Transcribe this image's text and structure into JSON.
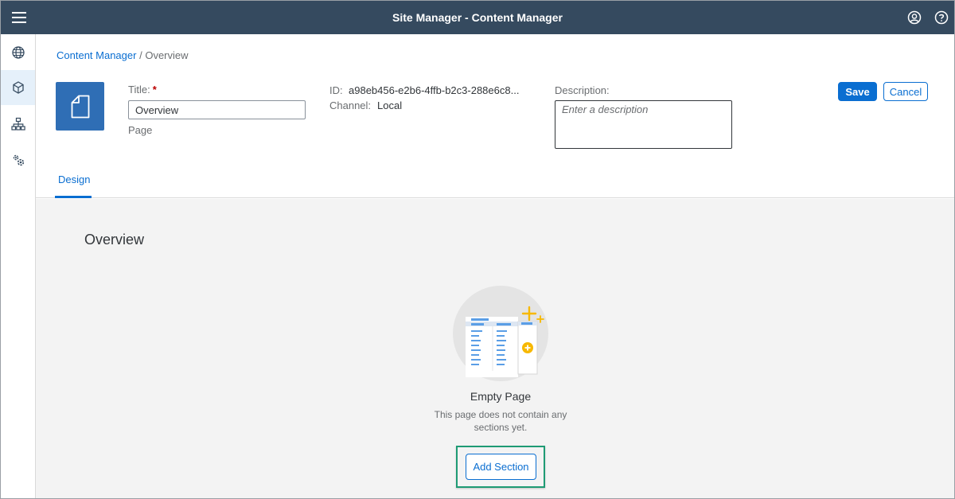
{
  "shell": {
    "title": "Site Manager - Content Manager"
  },
  "icons": {
    "menu": "hamburger-menu-icon",
    "user": "user-profile-icon",
    "help": "help-icon",
    "nav": [
      "globe-icon",
      "cube-icon",
      "hierarchy-icon",
      "settings-icon"
    ]
  },
  "breadcrumb": {
    "link": "Content Manager",
    "separator": "/",
    "current": "Overview"
  },
  "header": {
    "title_label": "Title:",
    "required_mark": "*",
    "title_value": "Overview",
    "type": "Page",
    "id_label": "ID:",
    "id_value": "a98eb456-e2b6-4ffb-b2c3-288e6c8...",
    "channel_label": "Channel:",
    "channel_value": "Local",
    "description_label": "Description:",
    "description_placeholder": "Enter a description",
    "save_label": "Save",
    "cancel_label": "Cancel"
  },
  "tabs": [
    {
      "label": "Design",
      "selected": true
    }
  ],
  "content": {
    "section_title": "Overview",
    "empty_title": "Empty Page",
    "empty_description": "This page does not contain any sections yet.",
    "add_section_label": "Add Section"
  },
  "colors": {
    "shell": "#354a5f",
    "accent": "#0a6ed1",
    "page_icon": "#2f6eb5",
    "highlight": "#1e9b74"
  }
}
